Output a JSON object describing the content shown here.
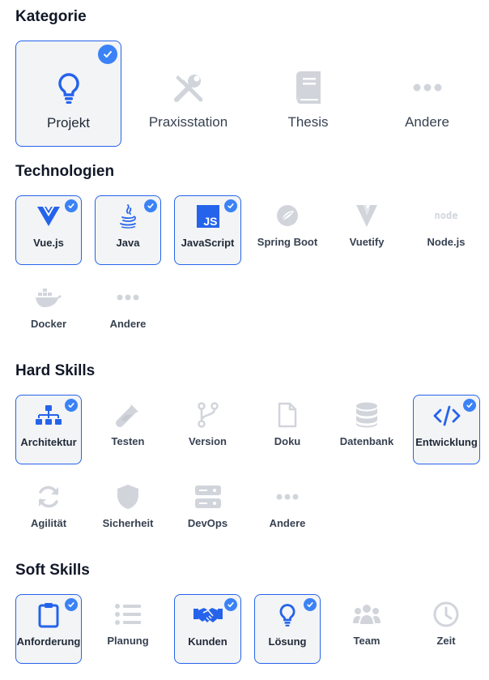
{
  "colors": {
    "accent": "#2563eb",
    "check": "#3b82f6",
    "inactive_icon": "#d1d5db",
    "selected_bg": "#f3f4f6"
  },
  "sections": {
    "kategorie": {
      "title": "Kategorie",
      "items": [
        {
          "label": "Projekt",
          "icon": "lightbulb-icon",
          "selected": true
        },
        {
          "label": "Praxisstation",
          "icon": "tools-icon",
          "selected": false
        },
        {
          "label": "Thesis",
          "icon": "book-icon",
          "selected": false
        },
        {
          "label": "Andere",
          "icon": "more-icon",
          "selected": false
        }
      ]
    },
    "technologien": {
      "title": "Technologien",
      "items": [
        {
          "label": "Vue.js",
          "icon": "vue-icon",
          "selected": true
        },
        {
          "label": "Java",
          "icon": "java-icon",
          "selected": true
        },
        {
          "label": "JavaScript",
          "icon": "javascript-icon",
          "icon_text": "JS",
          "selected": true
        },
        {
          "label": "Spring Boot",
          "icon": "spring-icon",
          "selected": false
        },
        {
          "label": "Vuetify",
          "icon": "vuetify-icon",
          "selected": false
        },
        {
          "label": "Node.js",
          "icon": "node-icon",
          "icon_text": "node",
          "selected": false
        },
        {
          "label": "Docker",
          "icon": "docker-icon",
          "selected": false
        },
        {
          "label": "Andere",
          "icon": "more-icon",
          "selected": false
        }
      ]
    },
    "hard_skills": {
      "title": "Hard Skills",
      "items": [
        {
          "label": "Architektur",
          "icon": "sitemap-icon",
          "selected": true
        },
        {
          "label": "Testen",
          "icon": "flask-icon",
          "selected": false
        },
        {
          "label": "Version",
          "icon": "branch-icon",
          "selected": false
        },
        {
          "label": "Doku",
          "icon": "file-icon",
          "selected": false
        },
        {
          "label": "Datenbank",
          "icon": "database-icon",
          "selected": false
        },
        {
          "label": "Entwicklung",
          "icon": "code-icon",
          "selected": true
        },
        {
          "label": "Agilität",
          "icon": "sync-icon",
          "selected": false
        },
        {
          "label": "Sicherheit",
          "icon": "shield-icon",
          "selected": false
        },
        {
          "label": "DevOps",
          "icon": "server-icon",
          "selected": false
        },
        {
          "label": "Andere",
          "icon": "more-icon",
          "selected": false
        }
      ]
    },
    "soft_skills": {
      "title": "Soft Skills",
      "items": [
        {
          "label": "Anforderung",
          "icon": "clipboard-icon",
          "selected": true
        },
        {
          "label": "Planung",
          "icon": "list-icon",
          "selected": false
        },
        {
          "label": "Kunden",
          "icon": "handshake-icon",
          "selected": true
        },
        {
          "label": "Lösung",
          "icon": "lightbulb-icon",
          "selected": true
        },
        {
          "label": "Team",
          "icon": "users-icon",
          "selected": false
        },
        {
          "label": "Zeit",
          "icon": "clock-icon",
          "selected": false
        }
      ]
    }
  }
}
